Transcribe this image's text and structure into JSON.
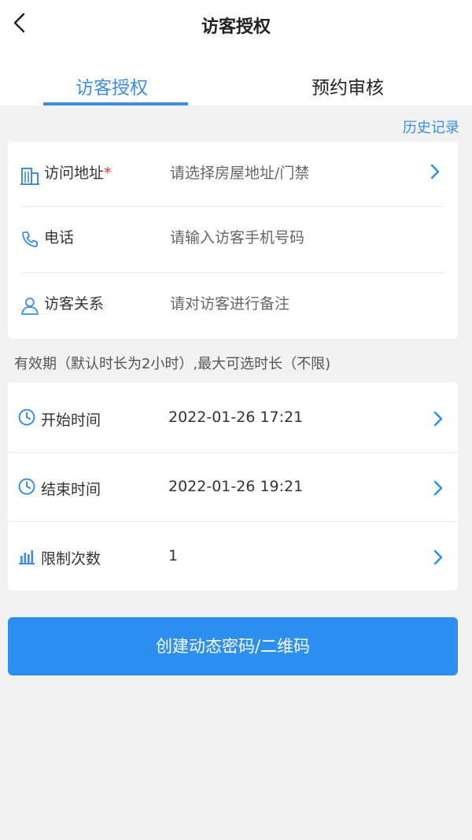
{
  "header": {
    "title": "访客授权",
    "back_icon": "chevron-left-icon"
  },
  "tabs": [
    {
      "label": "访客授权",
      "active": true
    },
    {
      "label": "预约审核",
      "active": false
    }
  ],
  "history_link": "历史记录",
  "visitor_form": {
    "address": {
      "label": "访问地址",
      "required_mark": "*",
      "placeholder": "请选择房屋地址/门禁",
      "icon": "building-icon"
    },
    "phone": {
      "label": "电话",
      "placeholder": "请输入访客手机号码",
      "icon": "phone-icon"
    },
    "relation": {
      "label": "访客关系",
      "placeholder": "请对访客进行备注",
      "icon": "user-icon"
    }
  },
  "validity_note": "有效期（默认时长为2小时）,最大可选时长（不限)",
  "time_settings": {
    "start": {
      "label": "开始时间",
      "value": "2022-01-26 17:21",
      "icon": "clock-icon"
    },
    "end": {
      "label": "结束时间",
      "value": "2022-01-26 19:21",
      "icon": "clock-icon"
    },
    "limit": {
      "label": "限制次数",
      "value": "1",
      "icon": "bar-chart-icon"
    }
  },
  "submit_button": "创建动态密码/二维码",
  "colors": {
    "accent": "#2d8ff0",
    "tab_active": "#3d8de0",
    "required": "#e0352b",
    "background": "#f2f2f2"
  }
}
